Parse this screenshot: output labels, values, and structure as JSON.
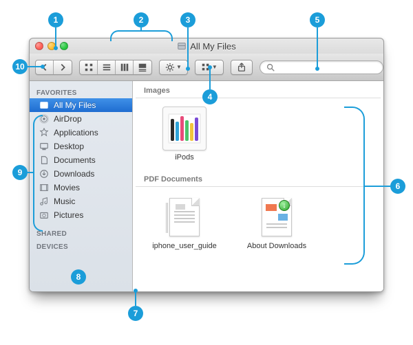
{
  "window": {
    "title": "All My Files",
    "traffic": {
      "close": "#ff5f57",
      "min": "#ffbd2e",
      "max": "#28c840"
    }
  },
  "toolbar": {
    "views": {
      "icon": "icon-view",
      "list": "list-view",
      "column": "column-view",
      "coverflow": "coverflow-view"
    },
    "action_label": "Action",
    "arrange_label": "Arrange",
    "share_label": "Share"
  },
  "search": {
    "placeholder": ""
  },
  "sidebar": {
    "sections": {
      "favorites": "FAVORITES",
      "shared": "SHARED",
      "devices": "DEVICES"
    },
    "items": [
      {
        "label": "All My Files",
        "icon": "all-my-files-icon",
        "selected": true
      },
      {
        "label": "AirDrop",
        "icon": "airdrop-icon"
      },
      {
        "label": "Applications",
        "icon": "applications-icon"
      },
      {
        "label": "Desktop",
        "icon": "desktop-icon"
      },
      {
        "label": "Documents",
        "icon": "documents-icon"
      },
      {
        "label": "Downloads",
        "icon": "downloads-icon"
      },
      {
        "label": "Movies",
        "icon": "movies-icon"
      },
      {
        "label": "Music",
        "icon": "music-icon"
      },
      {
        "label": "Pictures",
        "icon": "pictures-icon"
      }
    ]
  },
  "content": {
    "groups": [
      {
        "title": "Images",
        "items": [
          {
            "name": "iPods",
            "kind": "image"
          }
        ]
      },
      {
        "title": "PDF Documents",
        "items": [
          {
            "name": "iphone_user_guide",
            "kind": "pdf"
          },
          {
            "name": "About Downloads",
            "kind": "pdf-download"
          }
        ]
      }
    ]
  },
  "annotations": {
    "n1": "1",
    "n2": "2",
    "n3": "3",
    "n4": "4",
    "n5": "5",
    "n6": "6",
    "n7": "7",
    "n8": "8",
    "n9": "9",
    "n10": "10"
  }
}
